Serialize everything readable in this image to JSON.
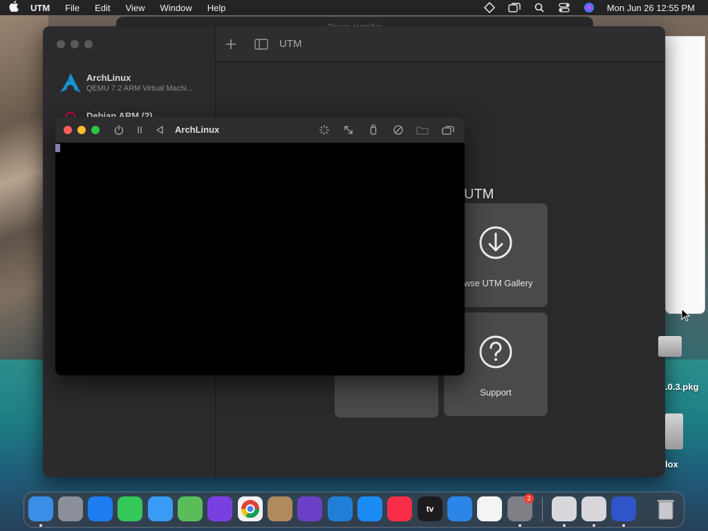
{
  "menubar": {
    "app_name": "UTM",
    "items": [
      "File",
      "Edit",
      "View",
      "Window",
      "Help"
    ],
    "clock": "Mon Jun 26  12:55 PM"
  },
  "installer": {
    "title": "Opera Installer"
  },
  "utm": {
    "toolbar_title": "UTM",
    "vms": [
      {
        "name": "ArchLinux",
        "description": "QEMU 7.2 ARM Virtual Machi..."
      },
      {
        "name": "Debian ARM (2)"
      }
    ],
    "welcome_title": "UTM",
    "cards": [
      {
        "label": "owse UTM Gallery",
        "icon": "download-circle-icon"
      },
      {
        "label": "Support",
        "icon": "question-circle-icon"
      }
    ]
  },
  "console": {
    "title": "ArchLinux"
  },
  "desktop": {
    "files": [
      {
        "label": ".0.3.pkg"
      },
      {
        "label": "lox"
      }
    ]
  },
  "dock": {
    "apps": [
      {
        "name": "finder",
        "color": "#3a8ee6"
      },
      {
        "name": "launchpad",
        "color": "#8a8f9a"
      },
      {
        "name": "safari",
        "color": "#1e7cf2"
      },
      {
        "name": "messages",
        "color": "#34c759"
      },
      {
        "name": "mail",
        "color": "#3a9bf5"
      },
      {
        "name": "maps",
        "color": "#5bbd5a"
      },
      {
        "name": "firefox",
        "color": "#7a3fe0"
      },
      {
        "name": "chrome",
        "color": "#f2f2f2"
      },
      {
        "name": "contacts",
        "color": "#b08a5a"
      },
      {
        "name": "visual-studio",
        "color": "#6c3fc7"
      },
      {
        "name": "vscode",
        "color": "#1f7fd6"
      },
      {
        "name": "app-store",
        "color": "#1c8cf5"
      },
      {
        "name": "music",
        "color": "#fa2d48"
      },
      {
        "name": "apple-tv",
        "color": "#1c1c1e"
      },
      {
        "name": "keynote",
        "color": "#2b86e8"
      },
      {
        "name": "news",
        "color": "#f4f4f4"
      },
      {
        "name": "system-settings",
        "color": "#7f7f86"
      },
      {
        "name": "downloads",
        "color": "#d8d8dc"
      },
      {
        "name": "opera-installer",
        "color": "#d8d8dc"
      },
      {
        "name": "utm",
        "color": "#2f56c9"
      },
      {
        "name": "trash",
        "color": "#b8b8bc"
      }
    ],
    "settings_badge": "2",
    "tv_label": "tv"
  },
  "colors": {
    "close": "#ff5f57",
    "minimize": "#febc2e",
    "zoom": "#28c840",
    "inactive": "#5a5a5c"
  }
}
